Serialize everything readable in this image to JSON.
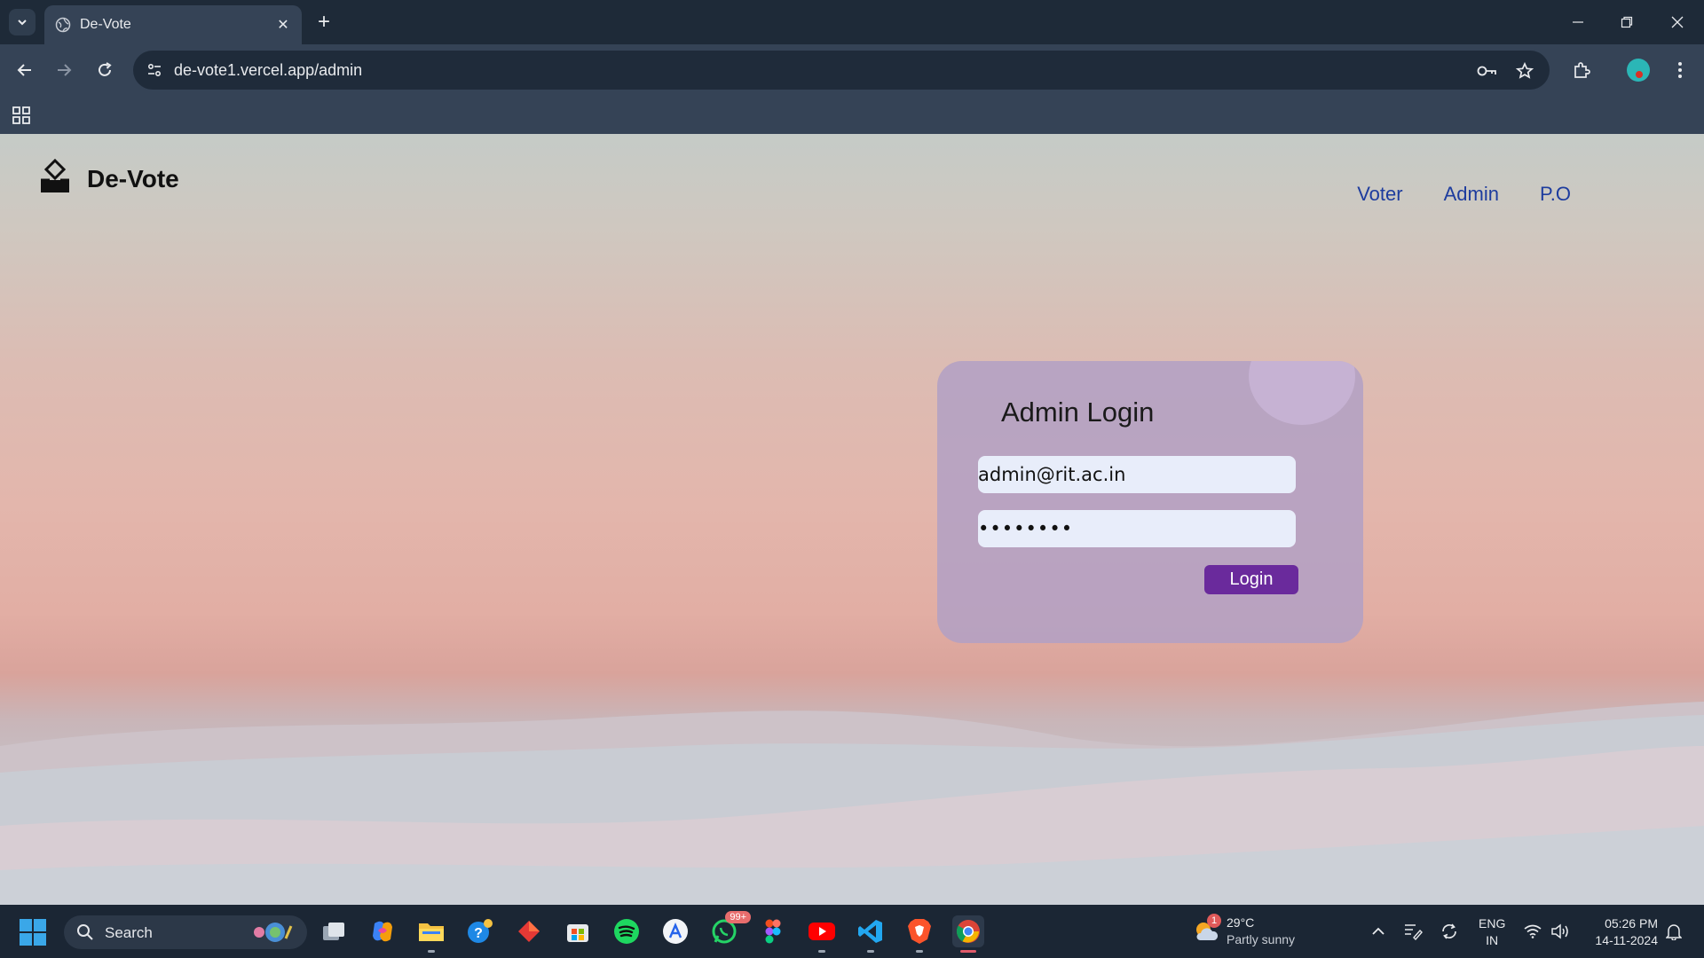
{
  "browser": {
    "tab_title": "De-Vote",
    "url": "de-vote1.vercel.app/admin"
  },
  "page": {
    "brand_name": "De-Vote",
    "nav": [
      "Voter",
      "Admin",
      "P.O"
    ],
    "login_card": {
      "title": "Admin Login",
      "email_value": "admin@rit.ac.in",
      "password_value": "••••••••",
      "login_button": "Login"
    }
  },
  "taskbar": {
    "search_label": "Search",
    "whatsapp_badge": "99+",
    "weather": {
      "badge": "1",
      "temperature": "29°C",
      "description": "Partly sunny"
    },
    "language": [
      "ENG",
      "IN"
    ],
    "time": "05:26 PM",
    "date": "14-11-2024"
  },
  "colors": {
    "chrome_dark": "#1e2a38",
    "chrome_toolbar": "#354356",
    "nav_link": "#1d3c9e",
    "login_button": "#6a2a9c",
    "card_bg": "#b2a0c4"
  }
}
